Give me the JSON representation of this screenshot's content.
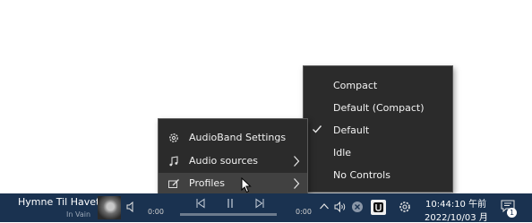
{
  "main_menu": {
    "items": [
      {
        "label": "AudioBand Settings",
        "icon": "gear-icon"
      },
      {
        "label": "Audio sources",
        "icon": "music-note-icon"
      },
      {
        "label": "Profiles",
        "icon": "profile-pencil-icon"
      }
    ]
  },
  "profiles_menu": {
    "items": [
      {
        "label": "Compact"
      },
      {
        "label": "Default (Compact)"
      },
      {
        "label": "Default",
        "checked": true
      },
      {
        "label": "Idle"
      },
      {
        "label": "No Controls"
      }
    ]
  },
  "taskbar": {
    "song_title": "Hymne Til Havet",
    "artist": "In Vain",
    "time_elapsed": "0:00",
    "time_total": "0:00",
    "progress": 0,
    "clock_time": "10:44:10 午前",
    "clock_date": "2022/10/03 月",
    "notification_count": "1"
  },
  "colors": {
    "taskbar_bg": "#1a3250",
    "menu_bg": "#2b2b2b",
    "menu_hover": "#414141"
  }
}
